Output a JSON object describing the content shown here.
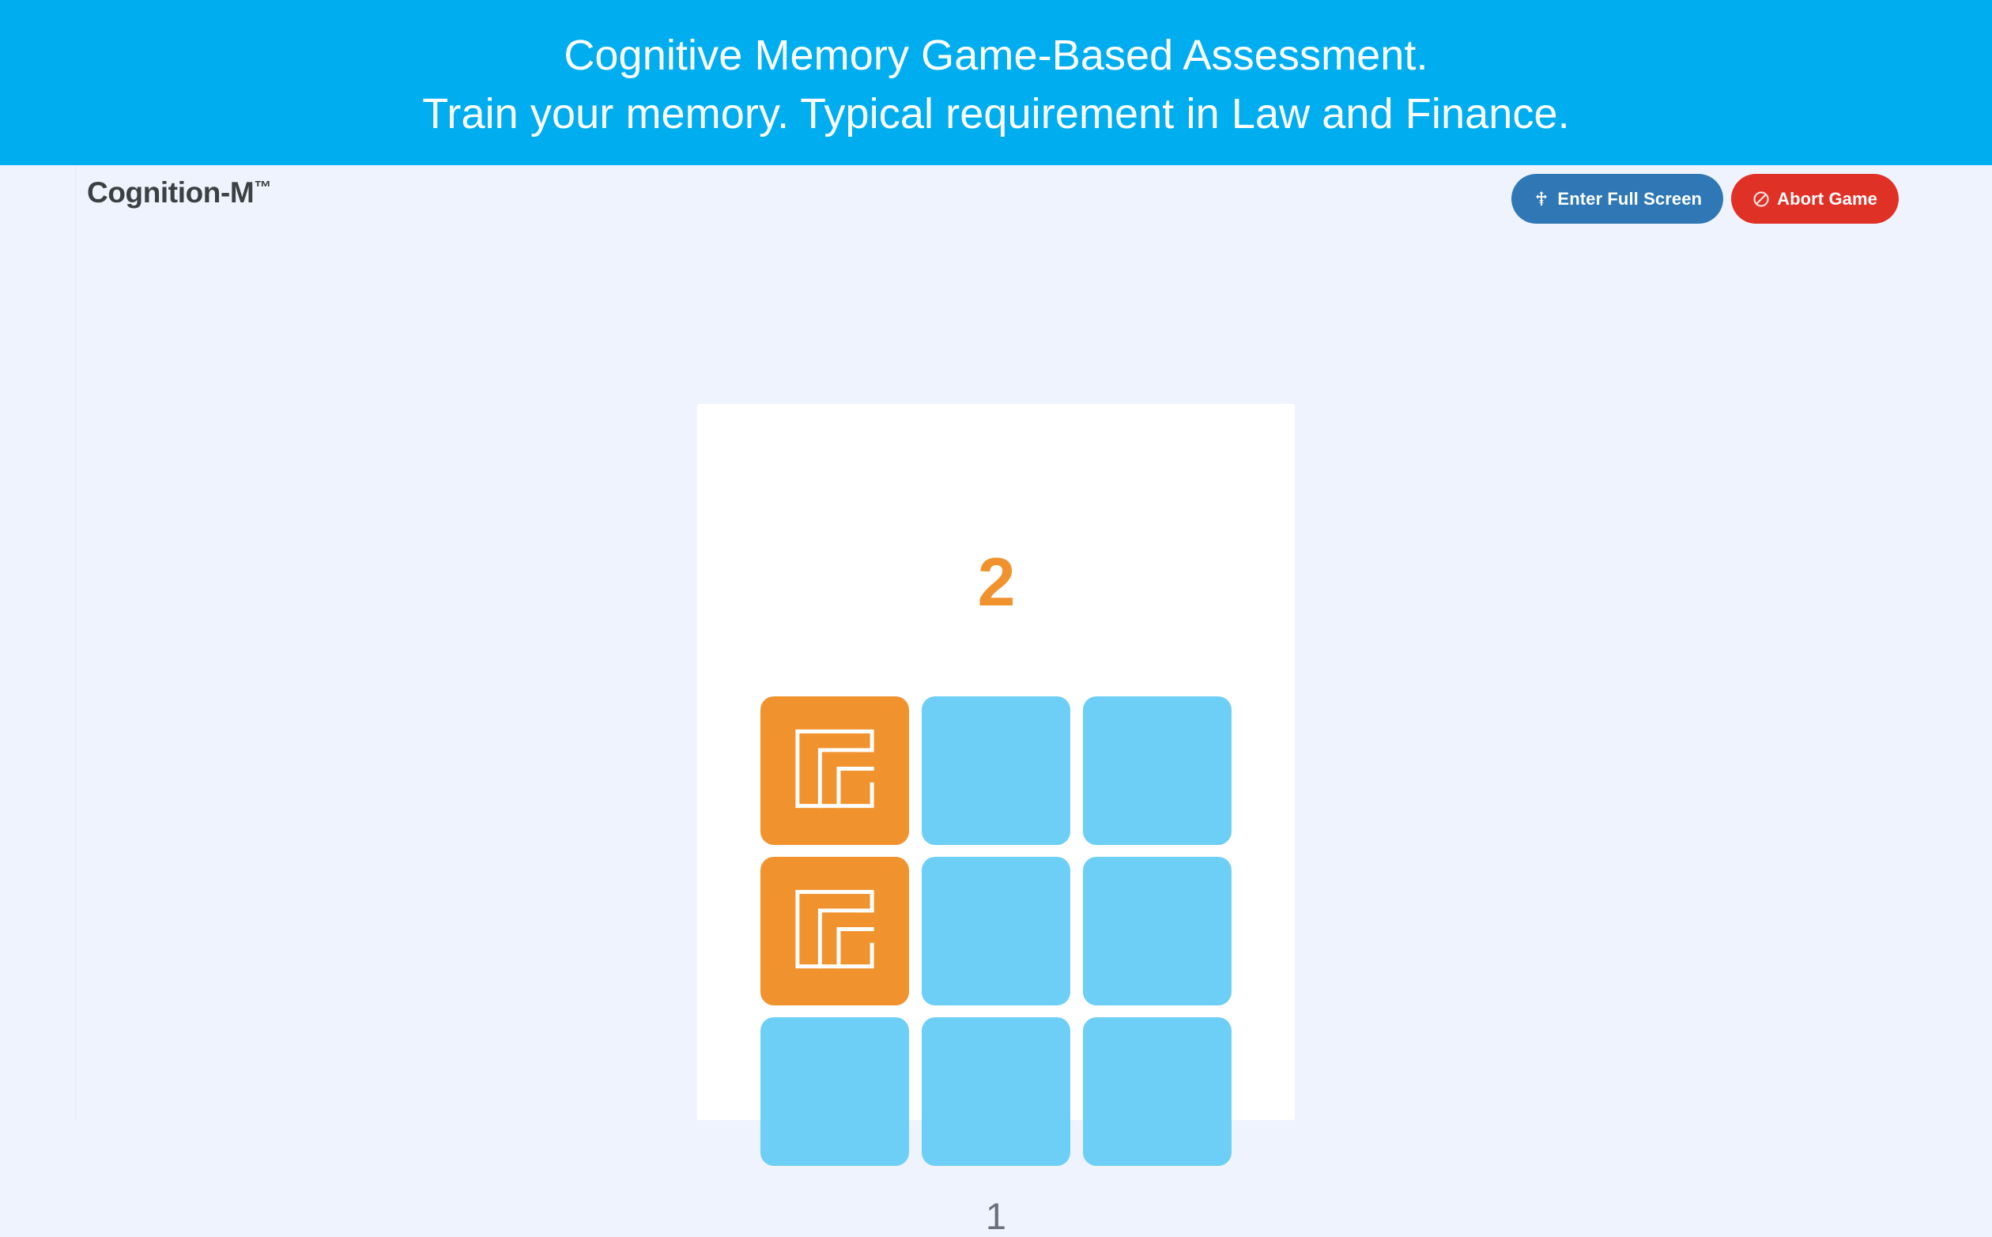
{
  "banner": {
    "line1": "Cognitive Memory Game-Based Assessment.",
    "line2": "Train your memory. Typical requirement in Law and Finance.",
    "background_color": "#00aeef",
    "text_color": "#ffffff"
  },
  "topbar": {
    "app_title": "Cognition-M",
    "app_title_mark": "™",
    "fullscreen_button": {
      "label": "Enter Full Screen",
      "icon": "arrows-alt-icon",
      "color": "#2f78b5"
    },
    "abort_button": {
      "label": "Abort Game",
      "icon": "ban-icon",
      "color": "#e03127"
    }
  },
  "game": {
    "round_number": "2",
    "score": "1",
    "round_color": "#f0932f",
    "score_color": "#6b6e7c",
    "card_background": "#ffffff",
    "tile_idle_color": "#6dcff6",
    "tile_active_color": "#f0932f",
    "tile_glyph": "maze-spiral-icon",
    "grid": {
      "rows": 3,
      "cols": 3,
      "cells": [
        {
          "id": "tile-r1c1",
          "state": "active",
          "glyph": true
        },
        {
          "id": "tile-r1c2",
          "state": "idle",
          "glyph": false
        },
        {
          "id": "tile-r1c3",
          "state": "idle",
          "glyph": false
        },
        {
          "id": "tile-r2c1",
          "state": "active",
          "glyph": true
        },
        {
          "id": "tile-r2c2",
          "state": "idle",
          "glyph": false
        },
        {
          "id": "tile-r2c3",
          "state": "idle",
          "glyph": false
        },
        {
          "id": "tile-r3c1",
          "state": "idle",
          "glyph": false
        },
        {
          "id": "tile-r3c2",
          "state": "idle",
          "glyph": false
        },
        {
          "id": "tile-r3c3",
          "state": "idle",
          "glyph": false
        }
      ]
    }
  },
  "page": {
    "background_color": "#eef3fd"
  }
}
